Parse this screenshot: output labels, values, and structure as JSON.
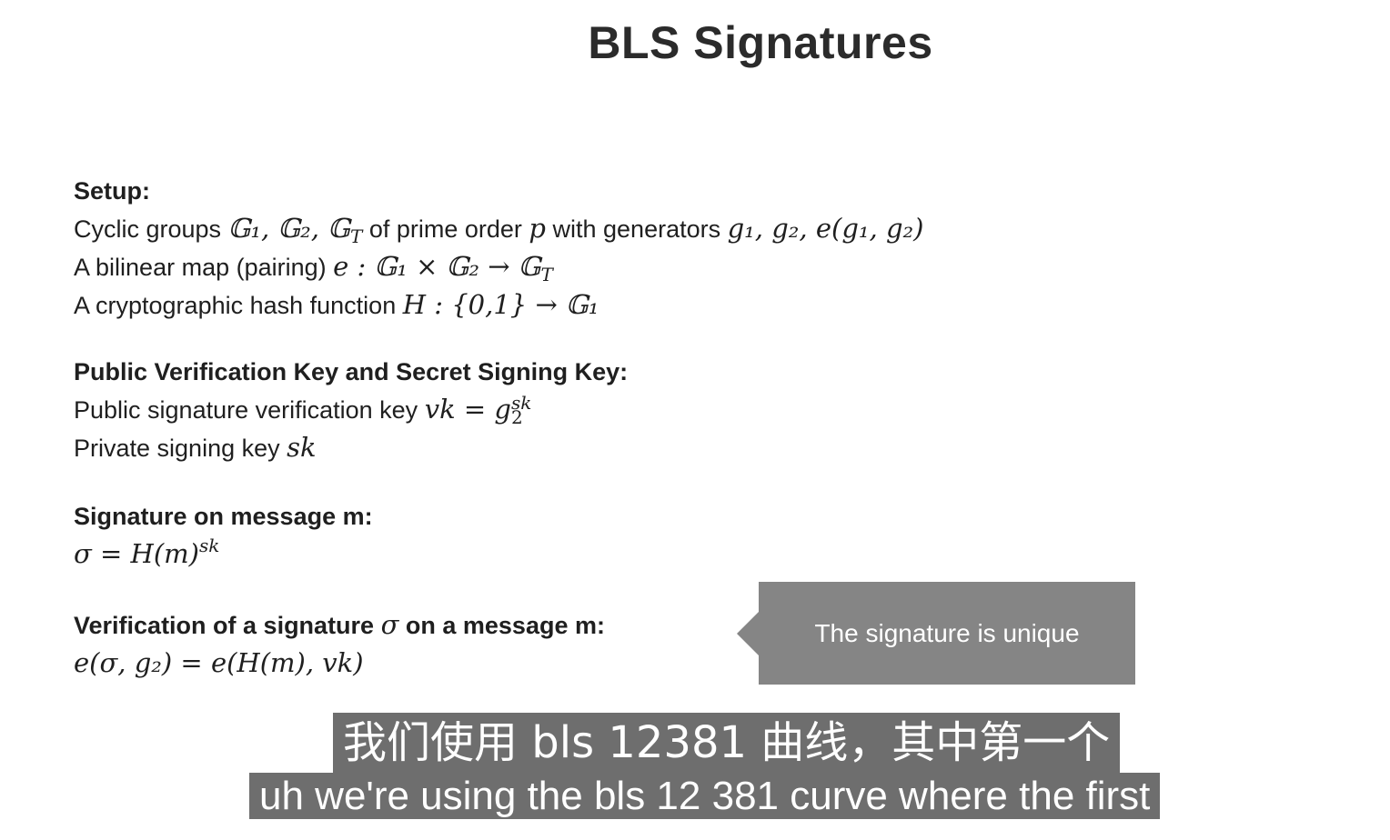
{
  "title": "BLS Signatures",
  "setup": {
    "heading": "Setup:",
    "line1_text": "Cyclic groups ",
    "line1_groups": "𝔾₁, 𝔾₂, 𝔾",
    "line1_groups_T": "T",
    "line1_mid": " of prime order ",
    "line1_p": "p",
    "line1_mid2": " with generators ",
    "line1_gens": "g₁, g₂, e(g₁, g₂)",
    "line2_text": "A bilinear map (pairing) ",
    "line2_math": "e : 𝔾₁ × 𝔾₂ → 𝔾",
    "line2_math_T": "T",
    "line3_text": "A cryptographic hash function ",
    "line3_math": "H : {0,1} → 𝔾₁"
  },
  "keys": {
    "heading": "Public Verification Key and Secret Signing Key:",
    "line1_text": "Public signature verification key ",
    "line1_math": "vk = g",
    "line1_sup": "sk",
    "line1_sub": "2",
    "line2_text": "Private signing key ",
    "line2_math": "sk"
  },
  "signature": {
    "heading": "Signature on message m:",
    "formula": "σ = H(m)",
    "formula_sup": "sk"
  },
  "verification": {
    "heading_pre": "Verification of a signature ",
    "heading_sigma": "σ",
    "heading_post": " on a message m:",
    "formula": "e(σ, g₂) = e(H(m), vk)"
  },
  "callout": {
    "text": "The signature is unique"
  },
  "subtitles": {
    "chinese": "我们使用 bls 12381 曲线，其中第一个",
    "english": "uh we're using the bls 12 381 curve where the first"
  },
  "colors": {
    "callout_bg": "#858585",
    "subtitle_bg": "#6e6e6e"
  }
}
